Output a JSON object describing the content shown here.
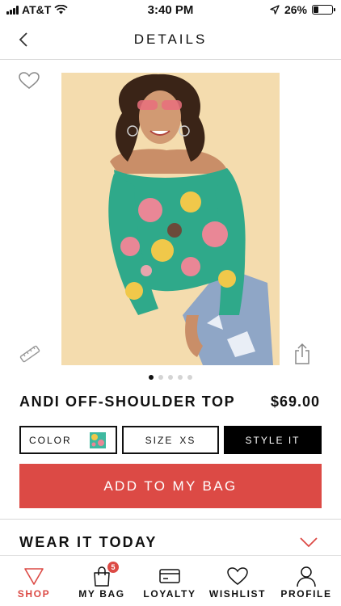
{
  "status_bar": {
    "carrier": "AT&T",
    "time": "3:40 PM",
    "battery": "26%",
    "battery_level": 0.26
  },
  "header": {
    "title": "DETAILS"
  },
  "product": {
    "name": "ANDI OFF-SHOULDER TOP",
    "price": "$69.00",
    "image_count": 5,
    "active_image_index": 0
  },
  "options": {
    "color_label": "COLOR",
    "size_label": "SIZE",
    "size_value": "XS",
    "style_label": "STYLE IT"
  },
  "cta": {
    "add_to_bag": "ADD TO MY BAG"
  },
  "wear_it_today": {
    "title": "WEAR IT TODAY"
  },
  "tabs": [
    {
      "label": "SHOP",
      "icon": "triangle-icon",
      "active": true
    },
    {
      "label": "MY BAG",
      "icon": "bag-icon",
      "badge": "5"
    },
    {
      "label": "LOYALTY",
      "icon": "card-icon"
    },
    {
      "label": "WISHLIST",
      "icon": "heart-icon"
    },
    {
      "label": "PROFILE",
      "icon": "person-icon"
    }
  ],
  "colors": {
    "accent": "#dc4a45",
    "text": "#111111",
    "style_button_bg": "#000000"
  }
}
